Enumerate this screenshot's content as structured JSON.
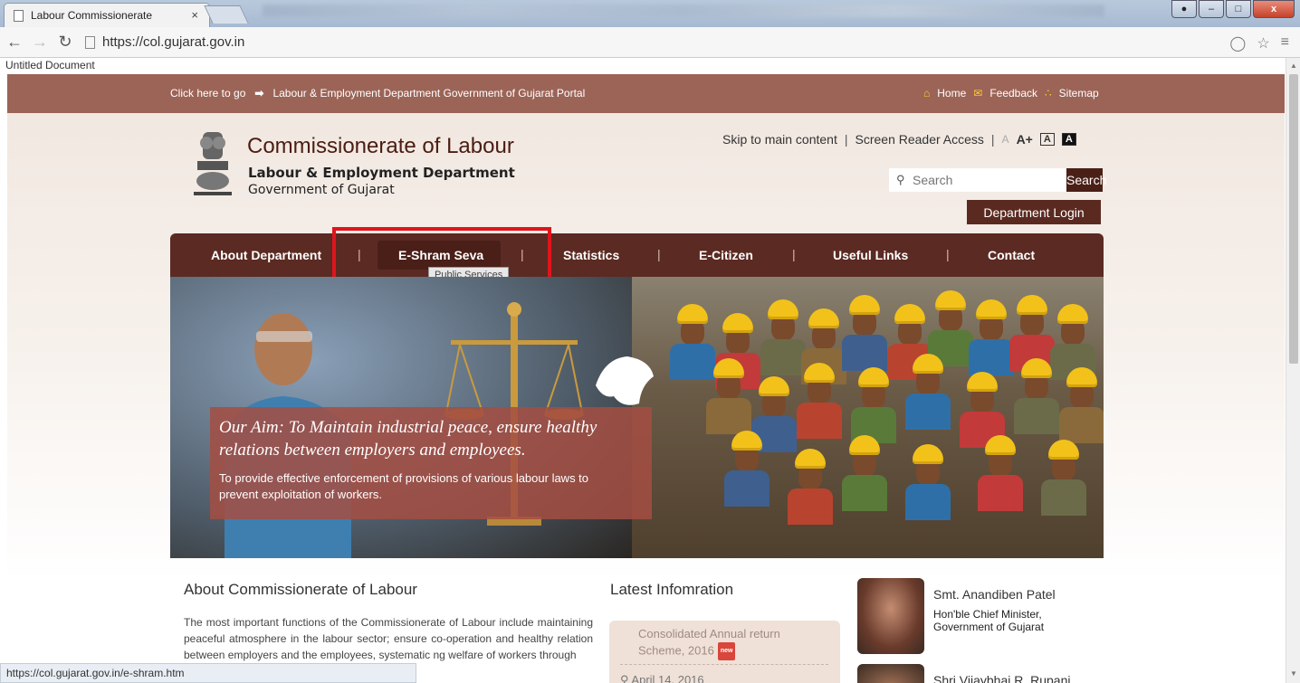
{
  "browser": {
    "tab_title": "Labour Commissionerate",
    "tab_close": "×",
    "url": "https://col.gujarat.gov.in",
    "doc_title": "Untitled Document",
    "status_url": "https://col.gujarat.gov.in/e-shram.htm",
    "win_minimize": "–",
    "win_maximize": "□",
    "win_close": "x"
  },
  "topstrip": {
    "click_here": "Click here to go",
    "portal_link": "Labour & Employment Department Government of Gujarat Portal",
    "home": "Home",
    "feedback": "Feedback",
    "sitemap": "Sitemap"
  },
  "header": {
    "title": "Commissionerate of Labour",
    "dept": "Labour & Employment Department",
    "govt": "Government of Gujarat",
    "skip": "Skip to main content",
    "screen_reader": "Screen Reader Access",
    "font_small": "A",
    "font_large": "A+",
    "contrast_light": "A",
    "contrast_dark": "A",
    "search_placeholder": "Search",
    "search_button": "Search",
    "dept_login": "Department Login"
  },
  "nav": {
    "items": [
      "About Department",
      "E-Shram Seva",
      "Statistics",
      "E-Citizen",
      "Useful Links",
      "Contact"
    ],
    "tooltip": "Public Services"
  },
  "banner": {
    "aim_title": "Our Aim: To Maintain industrial peace, ensure healthy relations between employers and employees.",
    "aim_text": "To provide effective enforcement of provisions of various labour laws to prevent exploitation of workers."
  },
  "about": {
    "title": "About Commissionerate of Labour",
    "text": "The most important functions of the Commissionerate of Labour include maintaining peaceful atmosphere in the labour sector; ensure co-operation and healthy relation between employers and the employees, systematic ng welfare of workers through"
  },
  "latest": {
    "title": "Latest Infomration",
    "item": "Consolidated Annual return Scheme, 2016",
    "badge": "new",
    "date": "April 14, 2016"
  },
  "leaders": [
    {
      "name": "Smt. Anandiben Patel",
      "role": "Hon'ble Chief Minister, Government of Gujarat"
    },
    {
      "name": "Shri Vijaybhai R. Rupani"
    }
  ]
}
